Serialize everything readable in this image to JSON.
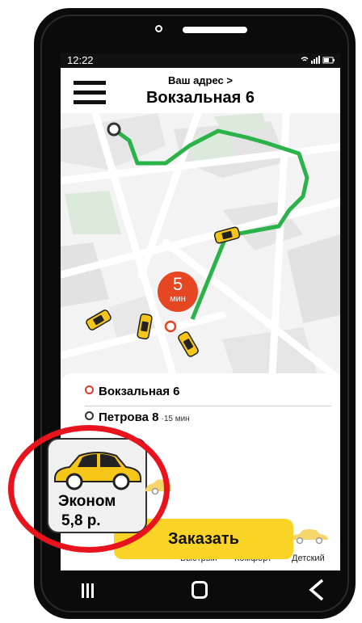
{
  "status_bar": {
    "time": "12:22",
    "icons": "wifi-icon signal-icon battery-icon"
  },
  "header": {
    "address_label": "Ваш адрес >",
    "address_value": "Вокзальная 6"
  },
  "map": {
    "eta_value": "5",
    "eta_unit": "мин"
  },
  "trip": {
    "from": "Вокзальная 6",
    "to": "Петрова 8",
    "to_time": "·15 мин"
  },
  "tariffs": [
    {
      "name": "Эконом",
      "price": "5,8 р.",
      "color": "#f5c518",
      "selected": true
    },
    {
      "name": "Быстрый",
      "color": "#d0d0d0",
      "selected": false
    },
    {
      "name": "Комфорт",
      "color": "#555555",
      "selected": false
    },
    {
      "name": "Детский",
      "color": "#f5c518",
      "selected": false
    }
  ],
  "order_button": {
    "label": "Заказать"
  },
  "colors": {
    "route": "#2bb34a",
    "accent": "#f9d326",
    "eta": "#e64621",
    "highlight": "#e8131c"
  }
}
